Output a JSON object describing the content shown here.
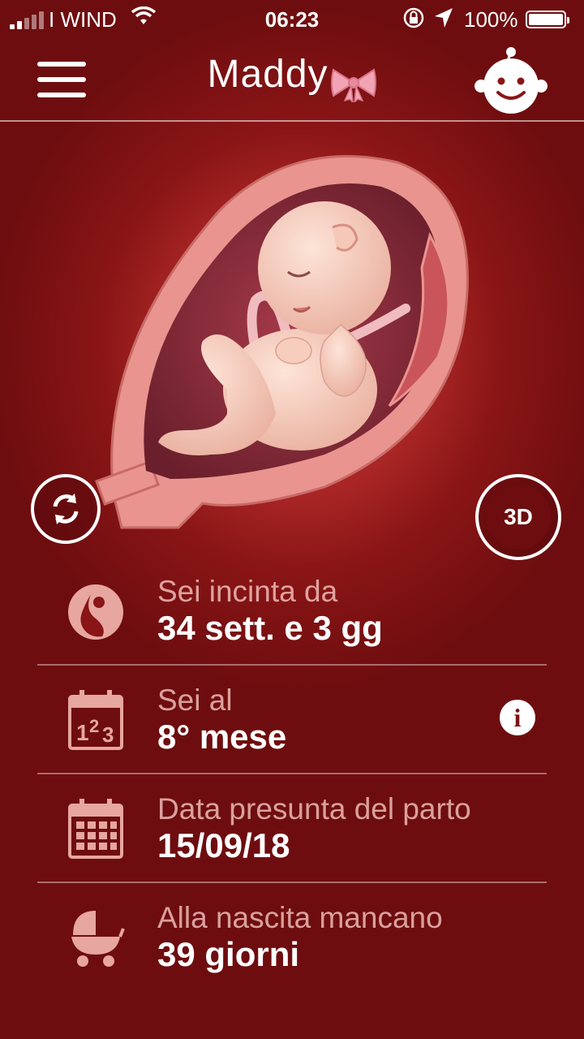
{
  "status_bar": {
    "carrier": "I WIND",
    "time": "06:23",
    "battery": "100%"
  },
  "nav": {
    "title": "Maddy",
    "menu_icon": "hamburger-icon",
    "profile_icon": "baby-face-icon"
  },
  "illustration": {
    "rotate_icon": "rotate-arrows-icon",
    "view3d_label": "3D"
  },
  "info": [
    {
      "label": "Sei incinta da",
      "value": "34 sett. e 3 gg",
      "icon": "belly-icon"
    },
    {
      "label": "Sei al",
      "value": "8° mese",
      "icon": "calendar-123-icon"
    },
    {
      "label": "Data presunta del parto",
      "value": "15/09/18",
      "icon": "calendar-grid-icon"
    },
    {
      "label": "Alla nascita mancano",
      "value": "39 giorni",
      "icon": "stroller-icon"
    }
  ],
  "info_button": "i",
  "colors": {
    "background": "#8a1516",
    "accent_pink": "#f2a4b4",
    "icon_tint": "#e7a6a0"
  }
}
